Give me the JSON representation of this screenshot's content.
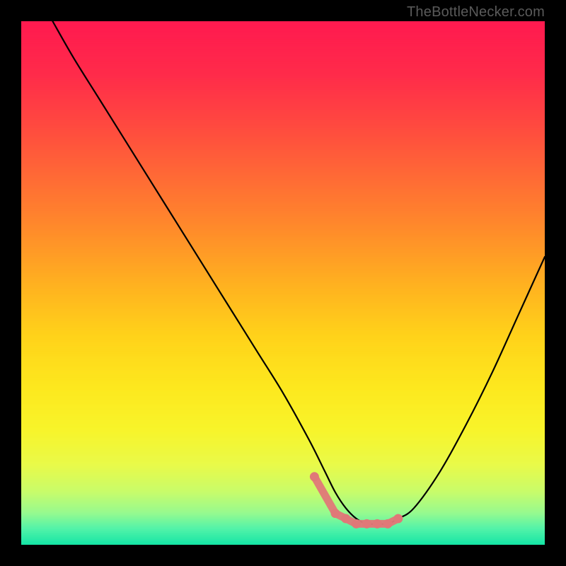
{
  "watermark": "TheBottleNecker.com",
  "colors": {
    "black": "#000000",
    "curve": "#000000",
    "marker": "#e07878"
  },
  "gradient_stops": [
    {
      "offset": 0.0,
      "color": "#ff1a4f"
    },
    {
      "offset": 0.1,
      "color": "#ff2b4a"
    },
    {
      "offset": 0.2,
      "color": "#ff4a3f"
    },
    {
      "offset": 0.3,
      "color": "#ff6b35"
    },
    {
      "offset": 0.4,
      "color": "#ff8c2a"
    },
    {
      "offset": 0.5,
      "color": "#ffb020"
    },
    {
      "offset": 0.6,
      "color": "#ffd21a"
    },
    {
      "offset": 0.7,
      "color": "#fde81e"
    },
    {
      "offset": 0.78,
      "color": "#f8f42a"
    },
    {
      "offset": 0.85,
      "color": "#e8fa4a"
    },
    {
      "offset": 0.9,
      "color": "#c8fc6a"
    },
    {
      "offset": 0.94,
      "color": "#98fa8e"
    },
    {
      "offset": 0.97,
      "color": "#55f3a8"
    },
    {
      "offset": 1.0,
      "color": "#18e6a6"
    }
  ],
  "chart_data": {
    "type": "line",
    "title": "",
    "xlabel": "",
    "ylabel": "",
    "xlim": [
      0,
      100
    ],
    "ylim": [
      0,
      100
    ],
    "grid": false,
    "legend": false,
    "series": [
      {
        "name": "bottleneck-curve",
        "x": [
          6,
          10,
          15,
          20,
          25,
          30,
          35,
          40,
          45,
          50,
          55,
          58,
          60,
          62,
          64,
          66,
          68,
          70,
          72,
          75,
          80,
          85,
          90,
          95,
          100
        ],
        "y": [
          100,
          93,
          85,
          77,
          69,
          61,
          53,
          45,
          37,
          29,
          20,
          14,
          10,
          7,
          5,
          4,
          4,
          4,
          5,
          7,
          14,
          23,
          33,
          44,
          55
        ]
      }
    ],
    "markers": {
      "name": "highlight-dots",
      "x": [
        56,
        60,
        62,
        64,
        66,
        68,
        70,
        72
      ],
      "y": [
        13,
        6,
        5,
        4,
        4,
        4,
        4,
        5
      ]
    }
  }
}
